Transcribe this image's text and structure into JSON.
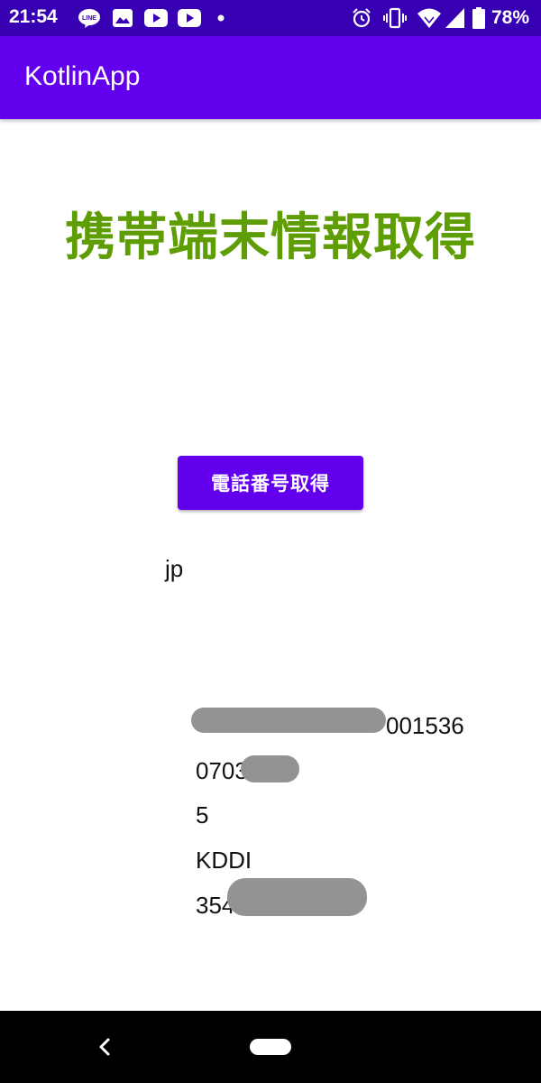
{
  "status_bar": {
    "time": "21:54",
    "battery": "78%",
    "left_icons": [
      "line-icon",
      "gallery-icon",
      "youtube-icon",
      "youtube-icon",
      "dot-icon"
    ],
    "right_icons": [
      "alarm-icon",
      "vibrate-icon",
      "wifi-icon",
      "signal-icon",
      "battery-icon"
    ]
  },
  "app_bar": {
    "title": "KotlinApp"
  },
  "main": {
    "heading": "携帯端末情報取得",
    "button_label": "電話番号取得",
    "country_code": "jp",
    "info_lines": [
      "001536",
      "0703 938",
      "5",
      "KDDI",
      "354 773"
    ]
  },
  "colors": {
    "status_bar": "#3700b3",
    "primary": "#6200ee",
    "heading": "#5f9d05",
    "redaction": "#939393"
  },
  "nav_bar": {
    "icons": [
      "back-icon",
      "home-icon"
    ]
  }
}
